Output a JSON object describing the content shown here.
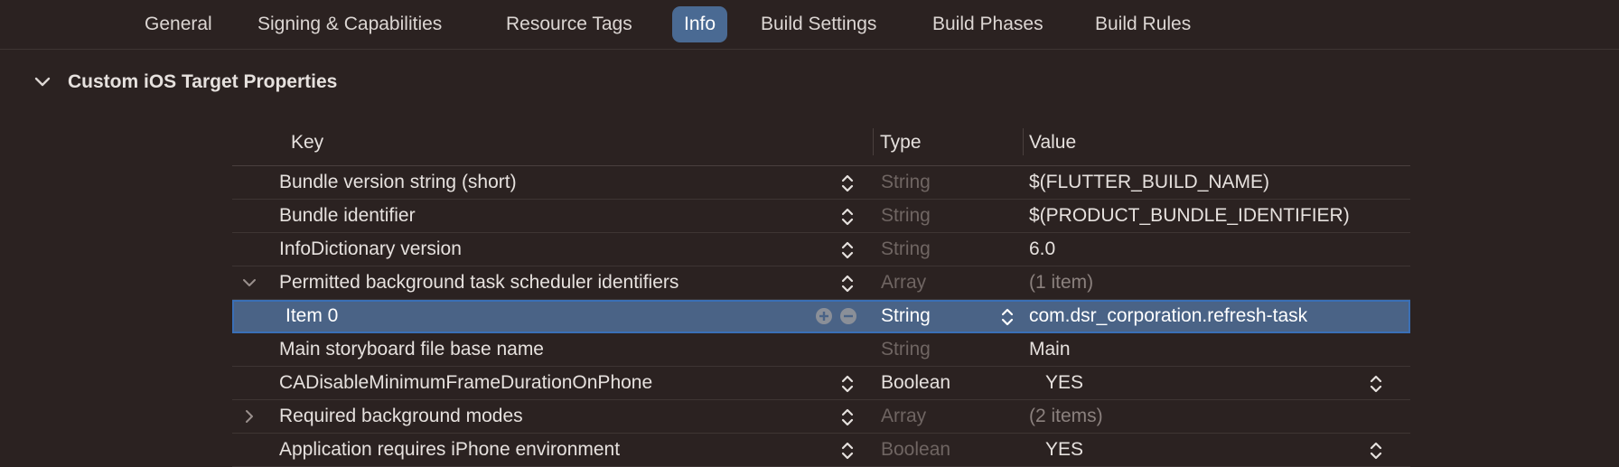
{
  "tabs": [
    {
      "label": "General"
    },
    {
      "label": "Signing & Capabilities"
    },
    {
      "label": "Resource Tags"
    },
    {
      "label": "Info",
      "active": true
    },
    {
      "label": "Build Settings"
    },
    {
      "label": "Build Phases"
    },
    {
      "label": "Build Rules"
    }
  ],
  "section": {
    "title": "Custom iOS Target Properties",
    "expanded": true
  },
  "table": {
    "headers": {
      "key": "Key",
      "type": "Type",
      "value": "Value"
    },
    "rows": [
      {
        "key": "Bundle version string (short)",
        "type": "String",
        "value": "$(FLUTTER_BUILD_NAME)"
      },
      {
        "key": "Bundle identifier",
        "type": "String",
        "value": "$(PRODUCT_BUNDLE_IDENTIFIER)"
      },
      {
        "key": "InfoDictionary version",
        "type": "String",
        "value": "6.0"
      },
      {
        "key": "Permitted background task scheduler identifiers",
        "type": "Array",
        "value": "(1 item)",
        "disclosure": "expanded"
      },
      {
        "key": "Item 0",
        "type": "String",
        "value": "com.dsr_corporation.refresh-task",
        "selected": true,
        "child": true
      },
      {
        "key": "Main storyboard file base name",
        "type": "String",
        "value": "Main"
      },
      {
        "key": "CADisableMinimumFrameDurationOnPhone",
        "type": "Boolean",
        "value": "YES"
      },
      {
        "key": "Required background modes",
        "type": "Array",
        "value": "(2 items)",
        "disclosure": "collapsed"
      },
      {
        "key": "Application requires iPhone environment",
        "type": "Boolean",
        "value": "YES"
      }
    ]
  },
  "icons": {
    "section_chevron": "chevron-down-icon",
    "stepper": "up-down-stepper-icon",
    "add": "plus-circle-icon",
    "remove": "minus-circle-icon"
  },
  "colors": {
    "background": "#2b2221",
    "active_tab": "#4a6a93",
    "selected_row": "#4a6386",
    "selection_border": "#3a6fb6"
  }
}
